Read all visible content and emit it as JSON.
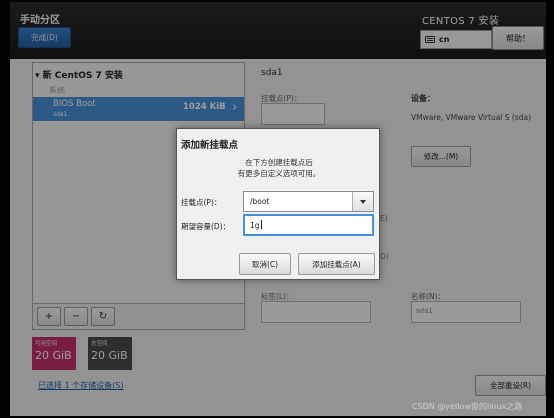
{
  "header": {
    "title": "手动分区",
    "done_label": "完成(D)",
    "os_title": "CENTOS 7 安装",
    "keyboard_layout": "cn",
    "help_label": "帮助！"
  },
  "left_panel": {
    "install_header": "▾ 新 CentOS 7 安装",
    "section_label": "系统",
    "mount_points": [
      {
        "name": "BIOS Boot",
        "device": "sda1",
        "size": "1024 KiB"
      }
    ],
    "toolbar": {
      "add_label": "+",
      "remove_label": "−",
      "refresh_label": "↻"
    }
  },
  "space": {
    "available_label": "可用空间",
    "available_value": "20 GiB",
    "total_label": "总空间",
    "total_value": "20 GiB"
  },
  "storage_link": "已选择 1 个存储设备(S)",
  "right_panel": {
    "title": "sda1",
    "mount_point_label": "挂载点(P)：",
    "device_label": "设备：",
    "device_value": "VMware, VMware Virtual S (sda)",
    "modify_label": "修改...(M)",
    "tag_label": "标签(L)：",
    "name_label": "名称(N)：",
    "name_value": "sda1",
    "reset_label": "全部重设(R)",
    "peek_e": "E)",
    "peek_o": "O)"
  },
  "dialog": {
    "title": "添加新挂载点",
    "description_line1": "在下方创建挂载点后",
    "description_line2": "有更多自定义选项可用。",
    "mount_point_label": "挂载点(P)：",
    "mount_point_value": "/boot",
    "capacity_label": "期望容量(D)：",
    "capacity_value": "1g",
    "cancel_label": "取消(C)",
    "add_label": "添加挂载点(A)"
  },
  "watermark": "CSDN @yellow俊的linux之路"
}
